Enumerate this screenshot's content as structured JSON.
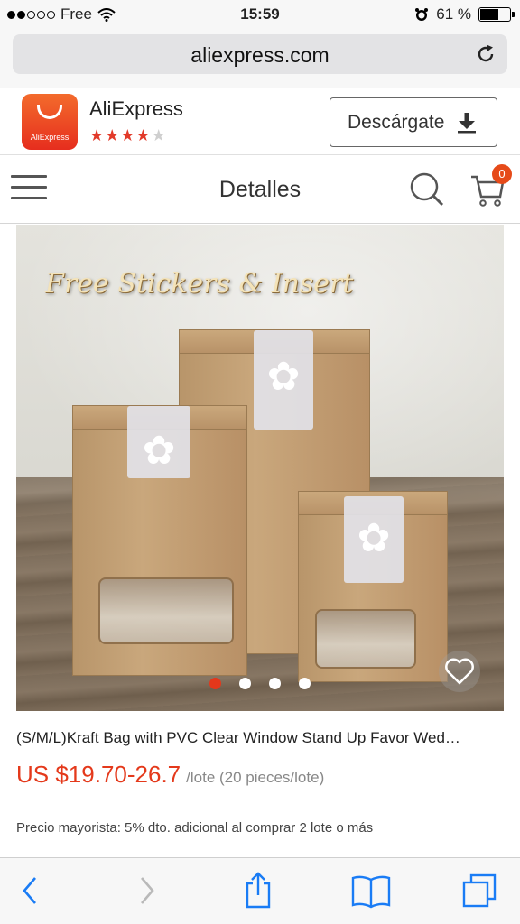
{
  "status_bar": {
    "carrier": "Free",
    "time": "15:59",
    "battery_text": "61 %",
    "battery_level": 0.61
  },
  "browser": {
    "url": "aliexpress.com"
  },
  "app_banner": {
    "app_name": "AliExpress",
    "app_icon_label": "AliExpress",
    "rating": 3.5,
    "rating_max": 5,
    "download_label": "Descárgate"
  },
  "navbar": {
    "title": "Detalles",
    "cart_count": "0"
  },
  "gallery": {
    "promo_text": "Free Stickers & Insert",
    "active_index": 0,
    "image_count": 4
  },
  "product": {
    "title": "(S/M/L)Kraft Bag with PVC Clear Window Stand Up Favor Wed…",
    "price": "US $19.70-26.7",
    "unit": "/lote (20 pieces/lote)",
    "wholesale": "Precio mayorista: 5% dto. adicional al comprar 2 lote o más"
  },
  "colors": {
    "accent": "#e4391b",
    "brand": "#e62e1e"
  }
}
